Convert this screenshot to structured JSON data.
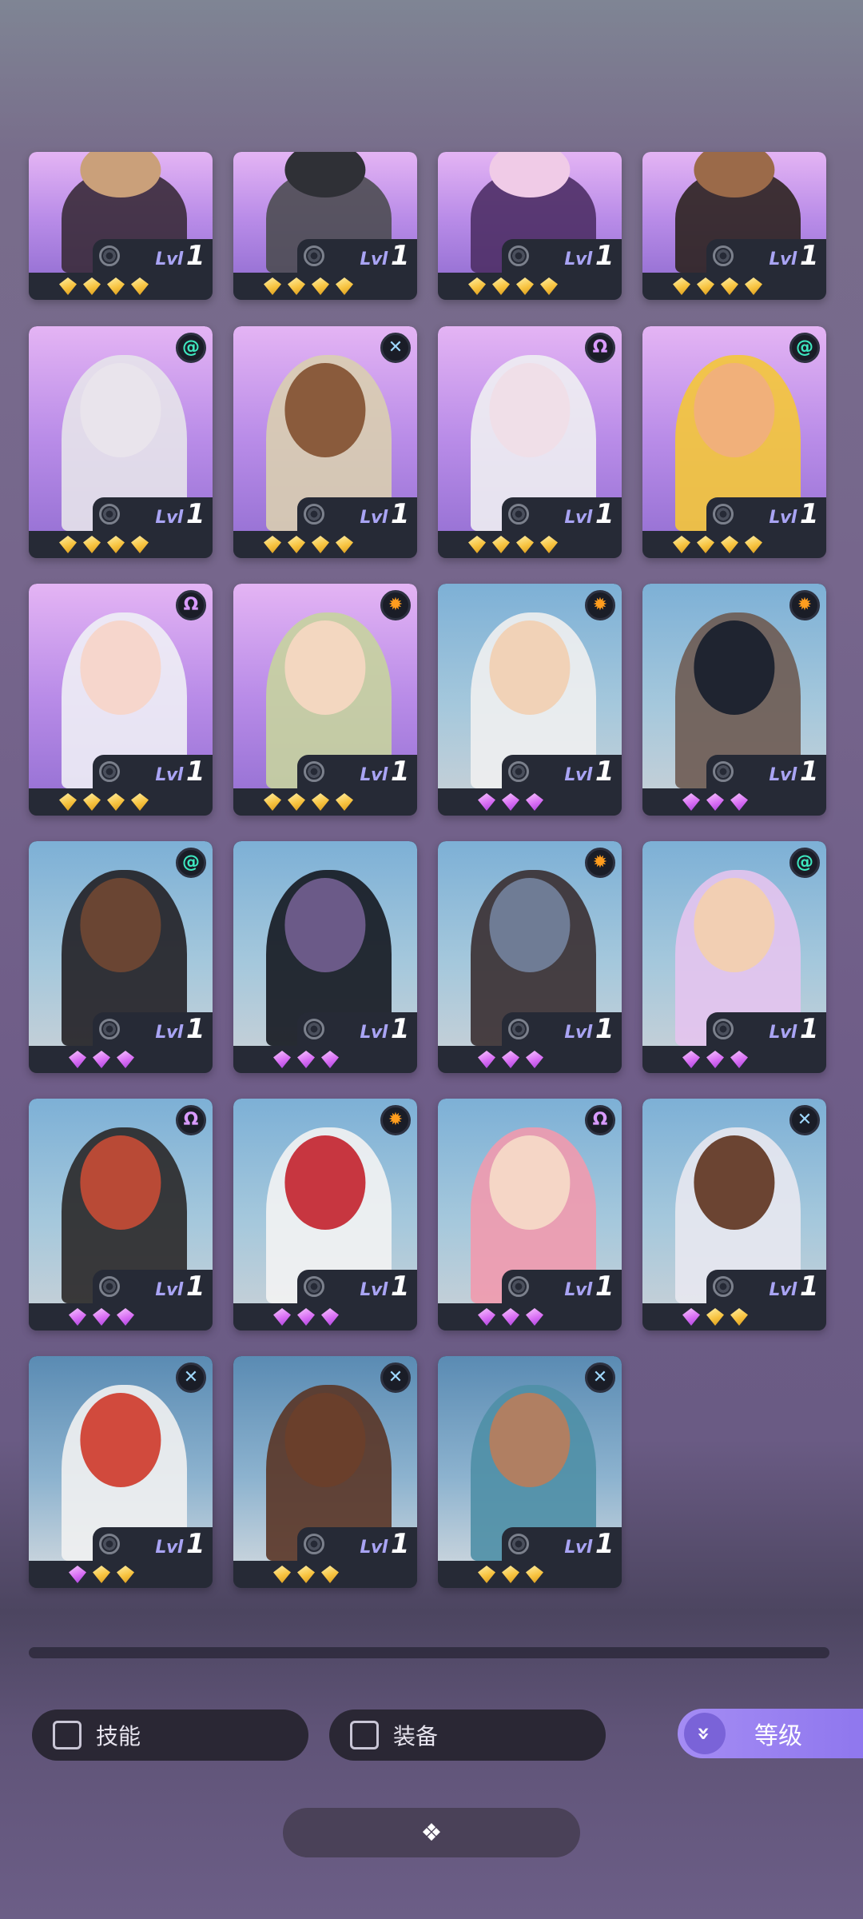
{
  "colors": {
    "card_bg": "#262a36",
    "level_prefix": "#a9a4f4",
    "gem_gold": "#f7c340",
    "gem_purple": "#d86ef4",
    "sort_button": "#9c85f2"
  },
  "heroes": [
    {
      "level_prefix": "Lvl",
      "level": "1",
      "stars": [
        "gold",
        "gold",
        "gold",
        "gold"
      ],
      "badge": null,
      "bg": "purple",
      "color": "#3a2b3a",
      "skin": "#caa07a"
    },
    {
      "level_prefix": "Lvl",
      "level": "1",
      "stars": [
        "gold",
        "gold",
        "gold",
        "gold"
      ],
      "badge": null,
      "bg": "purple",
      "color": "#4d4d52",
      "skin": "#2f3036"
    },
    {
      "level_prefix": "Lvl",
      "level": "1",
      "stars": [
        "gold",
        "gold",
        "gold",
        "gold"
      ],
      "badge": null,
      "bg": "purple",
      "color": "#4e2f66",
      "skin": "#f0cbe7"
    },
    {
      "level_prefix": "Lvl",
      "level": "1",
      "stars": [
        "gold",
        "gold",
        "gold",
        "gold"
      ],
      "badge": null,
      "bg": "purple",
      "color": "#2e2320",
      "skin": "#9b6a49"
    },
    {
      "level_prefix": "Lvl",
      "level": "1",
      "stars": [
        "gold",
        "gold",
        "gold",
        "gold"
      ],
      "badge": "spiral",
      "bg": "purple",
      "color": "#e6e3ea",
      "skin": "#e9e4ec"
    },
    {
      "level_prefix": "Lvl",
      "level": "1",
      "stars": [
        "gold",
        "gold",
        "gold",
        "gold"
      ],
      "badge": "cross",
      "bg": "purple",
      "color": "#d9ceb0",
      "skin": "#8a5b3c"
    },
    {
      "level_prefix": "Lvl",
      "level": "1",
      "stars": [
        "gold",
        "gold",
        "gold",
        "gold"
      ],
      "badge": "omega",
      "bg": "purple",
      "color": "#eeeef2",
      "skin": "#f0dfe8"
    },
    {
      "level_prefix": "Lvl",
      "level": "1",
      "stars": [
        "gold",
        "gold",
        "gold",
        "gold"
      ],
      "badge": "spiral",
      "bg": "purple",
      "color": "#f4c73a",
      "skin": "#f1b07a"
    },
    {
      "level_prefix": "Lvl",
      "level": "1",
      "stars": [
        "gold",
        "gold",
        "gold",
        "gold"
      ],
      "badge": "omega",
      "bg": "purple",
      "color": "#eeeef5",
      "skin": "#f6d6cc"
    },
    {
      "level_prefix": "Lvl",
      "level": "1",
      "stars": [
        "gold",
        "gold",
        "gold",
        "gold"
      ],
      "badge": "sun",
      "bg": "purple",
      "color": "#c7d39e",
      "skin": "#f3d7c0"
    },
    {
      "level_prefix": "Lvl",
      "level": "1",
      "stars": [
        "purple",
        "purple",
        "purple"
      ],
      "badge": "sun",
      "bg": "blue",
      "color": "#f0f0ef",
      "skin": "#f1d2b7"
    },
    {
      "level_prefix": "Lvl",
      "level": "1",
      "stars": [
        "purple",
        "purple",
        "purple"
      ],
      "badge": "sun",
      "bg": "blue",
      "color": "#6e5b52",
      "skin": "#1f2430"
    },
    {
      "level_prefix": "Lvl",
      "level": "1",
      "stars": [
        "purple",
        "purple",
        "purple"
      ],
      "badge": "spiral",
      "bg": "blue",
      "color": "#222025",
      "skin": "#6a4533"
    },
    {
      "level_prefix": "Lvl",
      "level": "1",
      "stars": [
        "purple",
        "purple",
        "purple"
      ],
      "badge": null,
      "bg": "blue",
      "color": "#151820",
      "skin": "#6b5a88"
    },
    {
      "level_prefix": "Lvl",
      "level": "1",
      "stars": [
        "purple",
        "purple",
        "purple"
      ],
      "badge": "sun",
      "bg": "blue",
      "color": "#3a2f31",
      "skin": "#6f7c95"
    },
    {
      "level_prefix": "Lvl",
      "level": "1",
      "stars": [
        "purple",
        "purple",
        "purple"
      ],
      "badge": "spiral",
      "bg": "blue",
      "color": "#e4c4ee",
      "skin": "#f2cfb3"
    },
    {
      "level_prefix": "Lvl",
      "level": "1",
      "stars": [
        "purple",
        "purple",
        "purple"
      ],
      "badge": "omega",
      "bg": "blue",
      "color": "#2a2828",
      "skin": "#b94a36"
    },
    {
      "level_prefix": "Lvl",
      "level": "1",
      "stars": [
        "purple",
        "purple",
        "purple"
      ],
      "badge": "sun",
      "bg": "blue",
      "color": "#f3f3f3",
      "skin": "#c73640"
    },
    {
      "level_prefix": "Lvl",
      "level": "1",
      "stars": [
        "purple",
        "purple",
        "purple"
      ],
      "badge": "omega",
      "bg": "blue",
      "color": "#f19aae",
      "skin": "#f5d6c6"
    },
    {
      "level_prefix": "Lvl",
      "level": "1",
      "stars": [
        "purple",
        "gold",
        "gold"
      ],
      "badge": "cross",
      "bg": "blue",
      "color": "#e8e8ef",
      "skin": "#6b4432"
    },
    {
      "level_prefix": "Lvl",
      "level": "1",
      "stars": [
        "purple",
        "gold",
        "gold"
      ],
      "badge": "cross",
      "bg": "blue2",
      "color": "#f1f1f1",
      "skin": "#d14a3d"
    },
    {
      "level_prefix": "Lvl",
      "level": "1",
      "stars": [
        "gold",
        "gold",
        "gold"
      ],
      "badge": "cross",
      "bg": "blue2",
      "color": "#5a3526",
      "skin": "#6a3f2b"
    },
    {
      "level_prefix": "Lvl",
      "level": "1",
      "stars": [
        "gold",
        "gold",
        "gold"
      ],
      "badge": "cross",
      "bg": "blue2",
      "color": "#4f8fa6",
      "skin": "#b07f62"
    }
  ],
  "filters": {
    "skills_label": "技能",
    "equipment_label": "装备"
  },
  "sort": {
    "label": "等级",
    "chevron": "»"
  },
  "bottom_handle": {
    "glyph": "❖"
  }
}
